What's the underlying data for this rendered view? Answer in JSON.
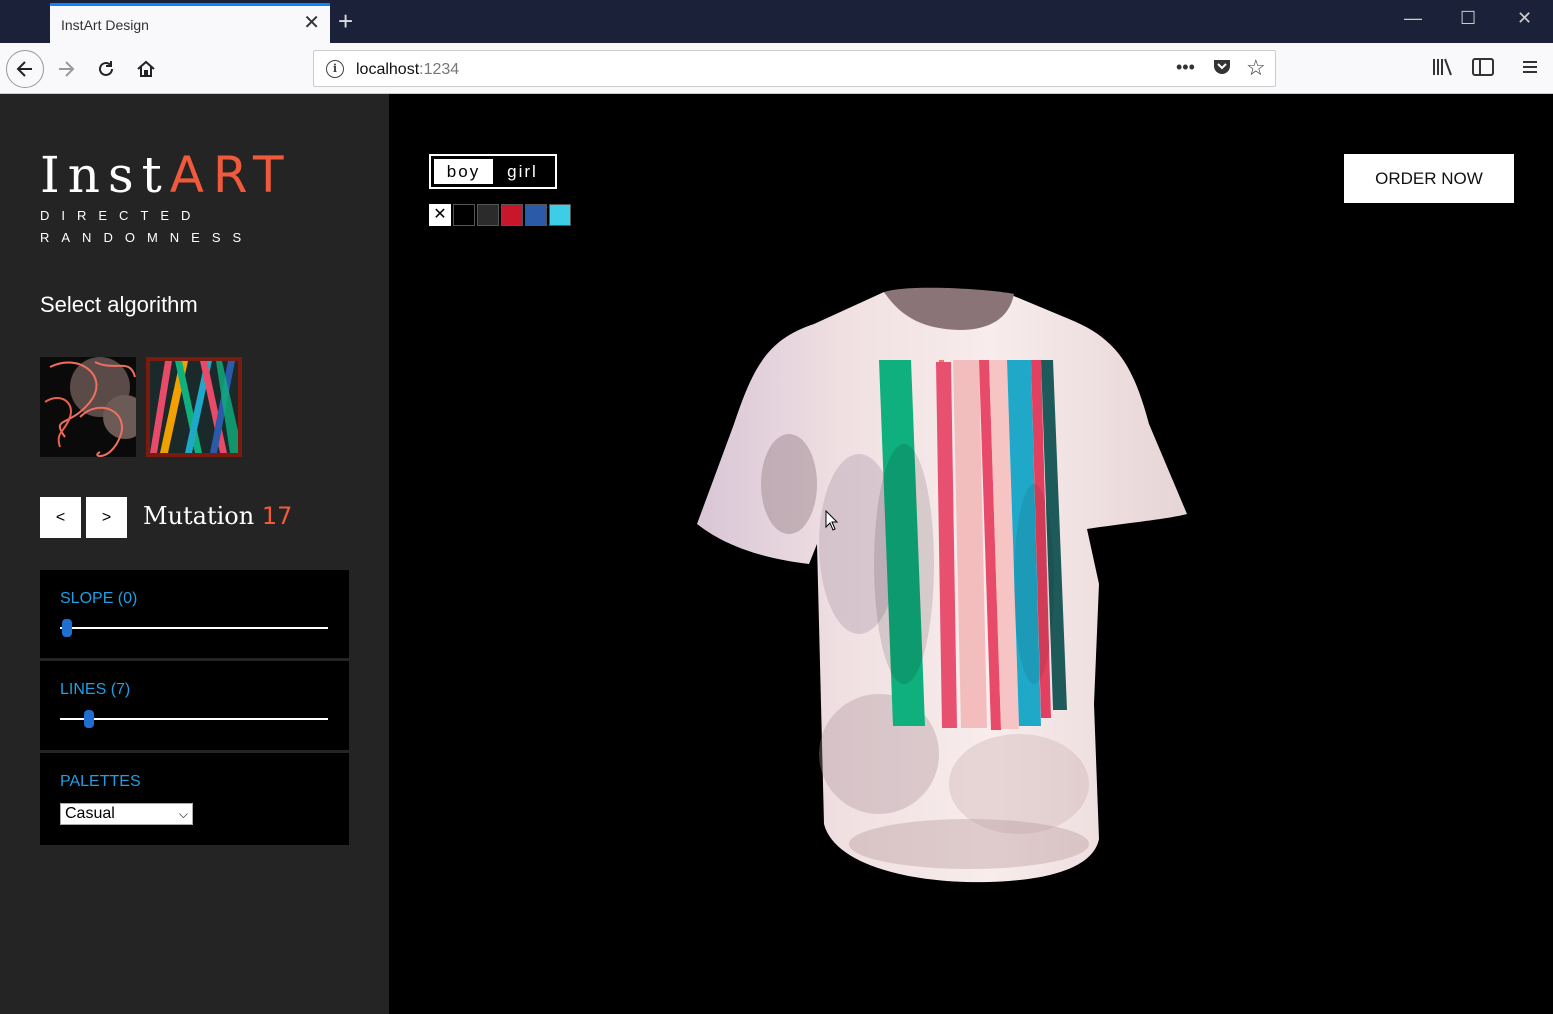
{
  "browser": {
    "tab_title": "InstArt Design",
    "url_host": "localhost",
    "url_port": ":1234"
  },
  "sidebar": {
    "logo_main": "Inst",
    "logo_accent": "ART",
    "tagline_1": "DIRECTED",
    "tagline_2": "RANDOMNESS",
    "select_title": "Select algorithm",
    "mutation_label": "Mutation",
    "mutation_number": "17",
    "prev_label": "<",
    "next_label": ">",
    "controls": {
      "slope_label": "SLOPE (0)",
      "slope_value": 0,
      "lines_label": "LINES (7)",
      "lines_value": 7,
      "palettes_label": "PALETTES",
      "palette_selected": "Casual"
    }
  },
  "main": {
    "gender_options": [
      "boy",
      "girl"
    ],
    "gender_selected": "boy",
    "swatch_none": "✕",
    "swatch_colors": [
      "#000000",
      "#2b2b2b",
      "#c8172b",
      "#2a5aa8",
      "#3ecde6"
    ],
    "order_label": "ORDER NOW",
    "stripe_colors": [
      "#0fb07e",
      "#f07a50",
      "#f2a0a8",
      "#e84a6a",
      "#f8b0b0",
      "#1fa8c8",
      "#e24060",
      "#1f5a5a"
    ]
  },
  "colors": {
    "accent": "#f05a3c",
    "link": "#1e9fe6",
    "sidebar_bg": "#242424"
  }
}
